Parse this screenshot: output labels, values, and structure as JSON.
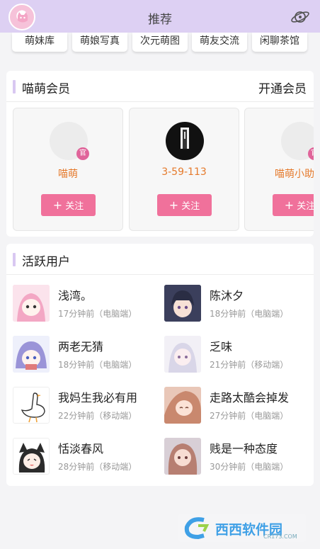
{
  "header": {
    "title": "推荐"
  },
  "categories": [
    {
      "label": "萌妹库"
    },
    {
      "label": "萌娘写真"
    },
    {
      "label": "次元萌图"
    },
    {
      "label": "萌友交流"
    },
    {
      "label": "闲聊茶馆"
    }
  ],
  "members": {
    "title": "喵萌会员",
    "open_label": "开通会员",
    "follow_label": "关注",
    "official_badge": "官",
    "cards": [
      {
        "name": "喵萌"
      },
      {
        "name": "3-59-113"
      },
      {
        "name": "喵萌小助手"
      }
    ]
  },
  "active": {
    "title": "活跃用户",
    "users": [
      {
        "name": "浅湾。",
        "time": "17分钟前（电脑端）"
      },
      {
        "name": "陈沐夕",
        "time": "18分钟前（电脑端）"
      },
      {
        "name": "两老无猜",
        "time": "18分钟前（电脑端）"
      },
      {
        "name": "乏味",
        "time": "21分钟前（移动端）"
      },
      {
        "name": "我妈生我必有用",
        "time": "22分钟前（移动端）"
      },
      {
        "name": "走路太酷会掉发",
        "time": "27分钟前（电脑端）"
      },
      {
        "name": "恬淡春风",
        "time": "28分钟前（移动端）"
      },
      {
        "name": "贱是一种态度",
        "time": "30分钟前（电脑端）"
      }
    ]
  },
  "watermark": {
    "text": "西西软件园",
    "sub": "CR173.COM"
  }
}
